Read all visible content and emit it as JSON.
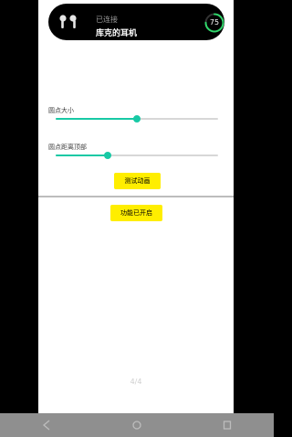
{
  "header": {
    "status": "已连接",
    "device_name": "库克的耳机",
    "battery_percent": 75,
    "battery_label": "75",
    "icons": {
      "device": "earbuds-icon"
    }
  },
  "sliders": [
    {
      "label": "圆点大小",
      "value_fraction": 0.5
    },
    {
      "label": "圆点距离顶部",
      "value_fraction": 0.32
    }
  ],
  "buttons": {
    "test_animation": "测试动画",
    "feature_enabled": "功能已开启"
  },
  "pager": {
    "text": "4/4"
  },
  "navbar": {
    "icons": [
      "back-icon",
      "home-icon",
      "recents-icon"
    ]
  },
  "colors": {
    "accent": "#18c9a5",
    "button": "#ffee00",
    "card": "#000000",
    "battery_ring": "#2fd66a"
  }
}
